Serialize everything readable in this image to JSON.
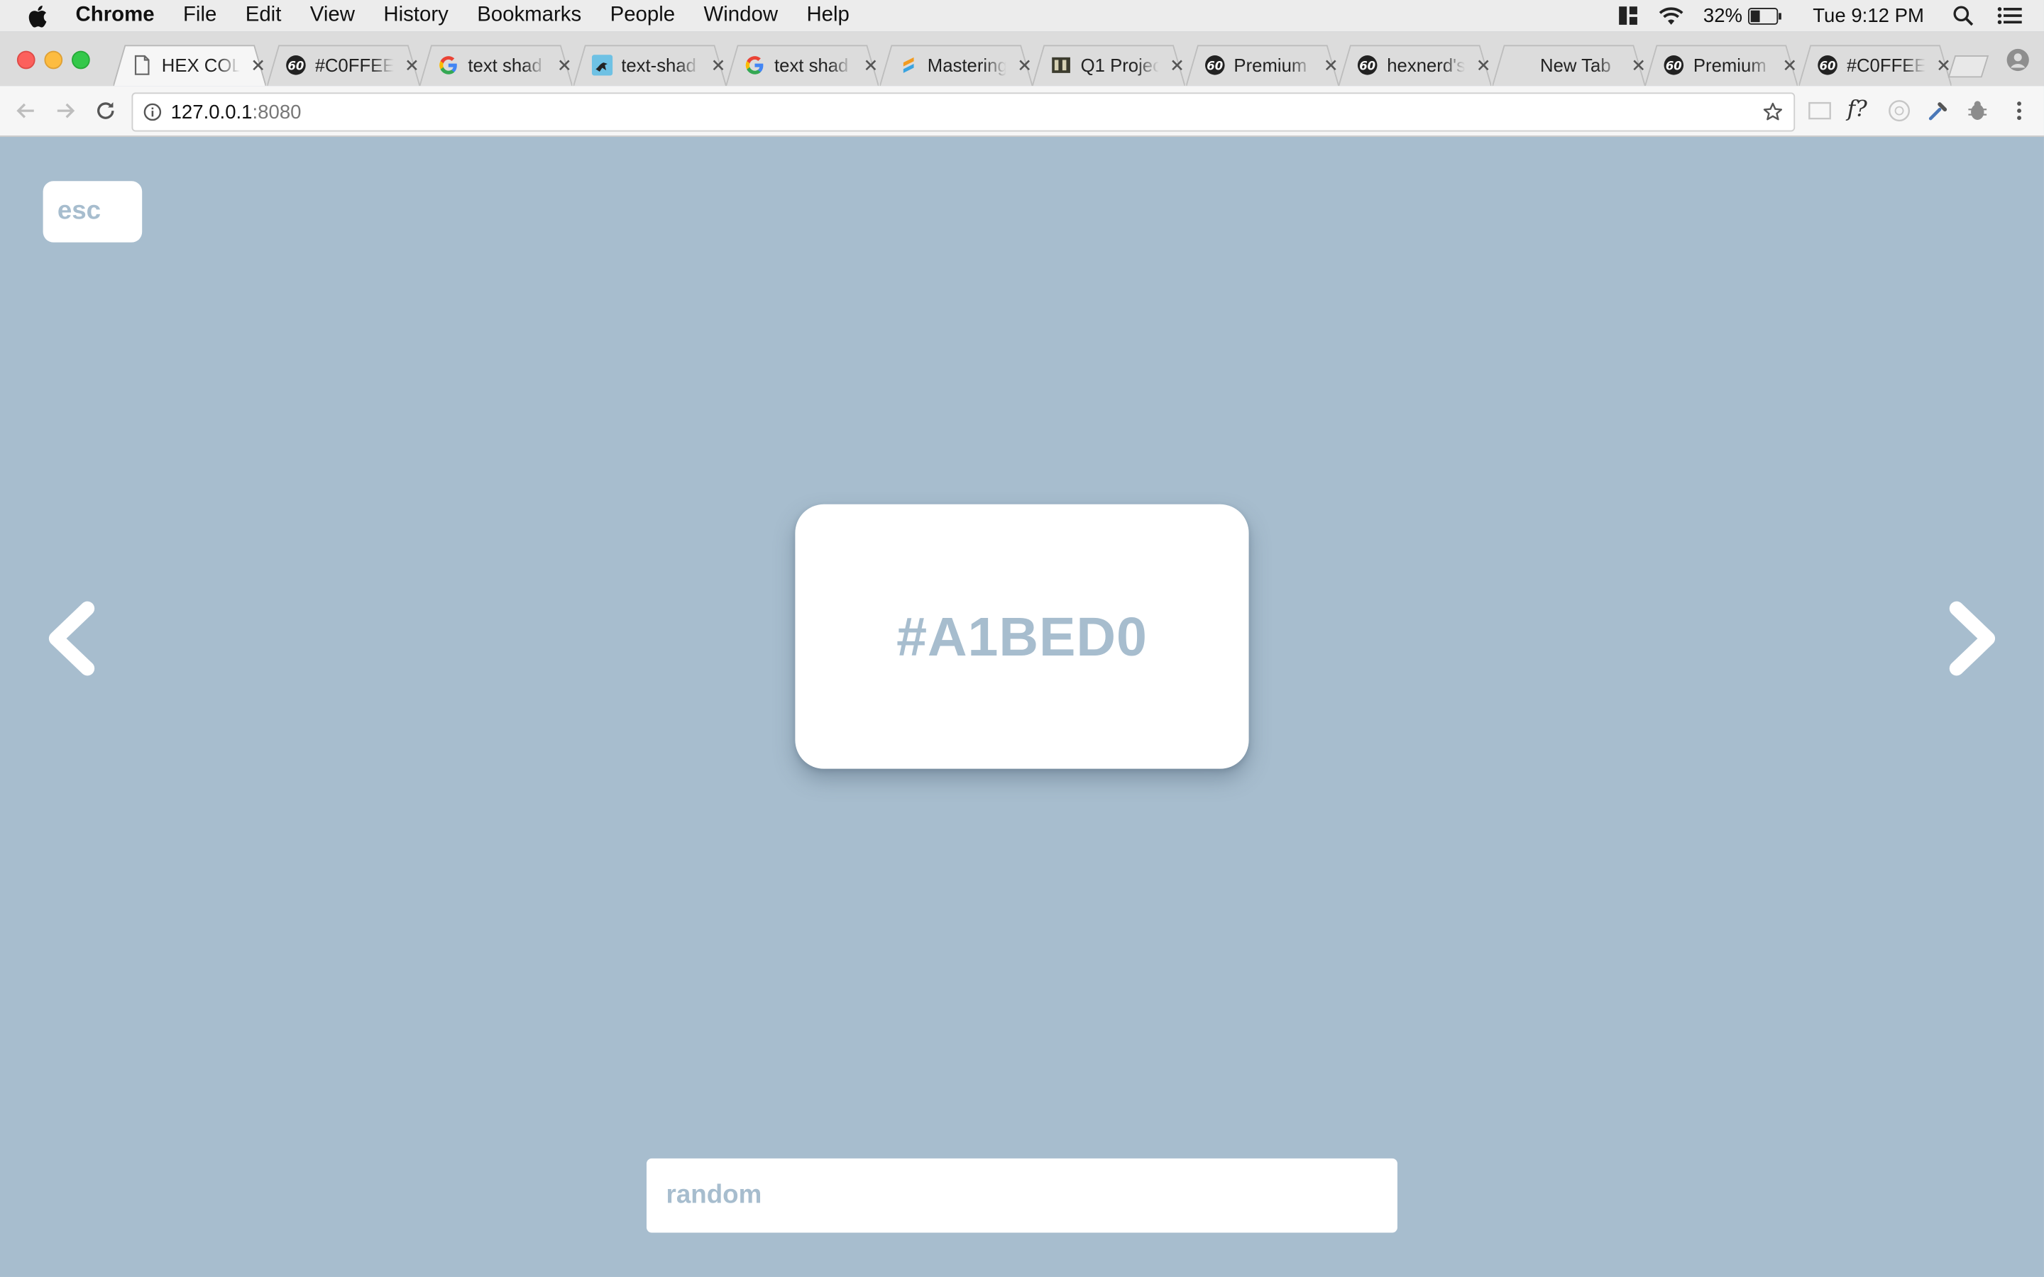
{
  "menubar": {
    "app_name": "Chrome",
    "items": [
      "File",
      "Edit",
      "View",
      "History",
      "Bookmarks",
      "People",
      "Window",
      "Help"
    ],
    "battery_percent": "32%",
    "clock": "Tue 9:12 PM"
  },
  "tabs": [
    {
      "title": "HEX COL",
      "icon": "document-icon",
      "active": true
    },
    {
      "title": "#C0FFEE",
      "icon": "sixty-icon"
    },
    {
      "title": "text shad",
      "icon": "google-icon"
    },
    {
      "title": "text-shad",
      "icon": "bird-icon"
    },
    {
      "title": "text shad",
      "icon": "google-icon"
    },
    {
      "title": "Mastering",
      "icon": "sublime-icon"
    },
    {
      "title": "Q1 Projec",
      "icon": "book-icon"
    },
    {
      "title": "Premium",
      "icon": "sixty-icon"
    },
    {
      "title": "hexnerd's",
      "icon": "sixty-icon"
    },
    {
      "title": "New Tab",
      "icon": "none"
    },
    {
      "title": "Premium",
      "icon": "sixty-icon"
    },
    {
      "title": "#C0FFEE",
      "icon": "sixty-icon"
    }
  ],
  "omnibox": {
    "url_host": "127.0.0.1",
    "url_port": ":8080"
  },
  "extensions": {
    "font_ext_label": "f?"
  },
  "page": {
    "background_color": "#A7BDCE",
    "esc_label": "esc",
    "hex_label": "#A1BED0",
    "random_placeholder": "random",
    "prev_icon": "chevron-left-icon",
    "next_icon": "chevron-right-icon"
  }
}
